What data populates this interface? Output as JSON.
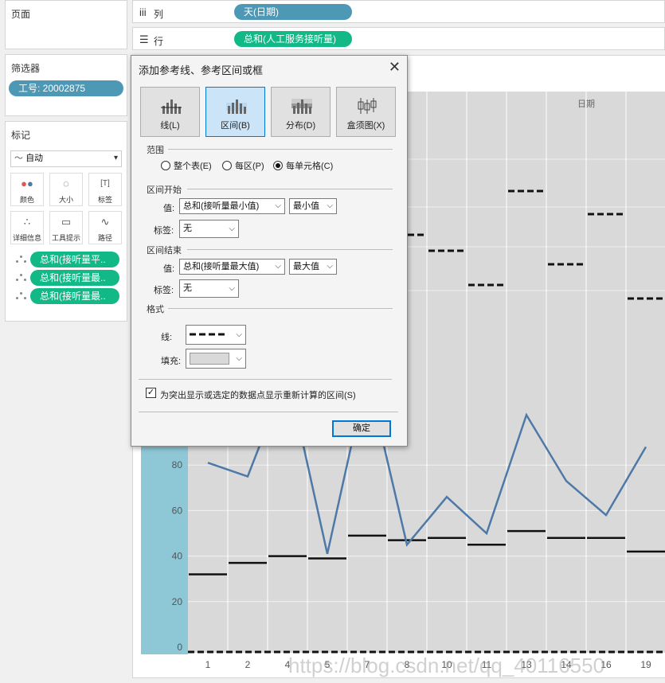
{
  "left": {
    "pages_title": "页面",
    "filters_title": "筛选器",
    "filter_pill": "工号: 20002875",
    "marks_title": "标记",
    "mark_type": "自动",
    "mark_buttons": [
      {
        "label": "颜色",
        "icon": "color-dots-icon"
      },
      {
        "label": "大小",
        "icon": "size-icon"
      },
      {
        "label": "标签",
        "icon": "label-icon"
      },
      {
        "label": "详细信息",
        "icon": "detail-icon"
      },
      {
        "label": "工具提示",
        "icon": "tooltip-icon"
      },
      {
        "label": "路径",
        "icon": "path-icon"
      }
    ],
    "mark_fields": [
      "总和(接听量平..",
      "总和(接听量最..",
      "总和(接听量最.."
    ]
  },
  "shelves": {
    "columns_label": "列",
    "columns_pill": "天(日期)",
    "rows_label": "行",
    "rows_pill": "总和(人工服务接听量)"
  },
  "chart_header": "日期",
  "dialog": {
    "title": "添加参考线、参考区间或框",
    "types": [
      {
        "label": "线(L)",
        "active": false
      },
      {
        "label": "区间(B)",
        "active": true
      },
      {
        "label": "分布(D)",
        "active": false
      },
      {
        "label": "盒须图(X)",
        "active": false
      }
    ],
    "scope_title": "范围",
    "scope_options": [
      {
        "label": "整个表(E)",
        "selected": false
      },
      {
        "label": "每区(P)",
        "selected": false
      },
      {
        "label": "每单元格(C)",
        "selected": true
      }
    ],
    "start_title": "区间开始",
    "value_label": "值:",
    "label_label": "标签:",
    "start_value": "总和(接听量最小值)",
    "start_agg": "最小值",
    "start_tag": "无",
    "end_title": "区间结束",
    "end_value": "总和(接听量最大值)",
    "end_agg": "最大值",
    "end_tag": "无",
    "format_title": "格式",
    "line_label": "线:",
    "fill_label": "填充:",
    "recalc_label": "为突出显示或选定的数据点显示重新计算的区间(S)",
    "recalc_checked": true,
    "ok_label": "确定"
  },
  "chart_data": {
    "type": "line",
    "x_tick_labels": [
      "1",
      "2",
      "4",
      "5",
      "7",
      "8",
      "10",
      "11",
      "13",
      "14",
      "16",
      "19"
    ],
    "y_tick_labels": [
      "0",
      "20",
      "40",
      "60",
      "80"
    ],
    "ylim": [
      0,
      100
    ],
    "series": [
      {
        "name": "总和(人工服务接听量)",
        "color": "#4e79a7",
        "values": [
          81,
          75,
          120,
          41,
          120,
          45,
          66,
          50,
          102,
          73,
          58,
          88
        ]
      }
    ],
    "band_bottom_values": [
      32,
      37,
      40,
      39,
      49,
      47,
      48,
      45,
      51,
      48,
      48,
      42
    ],
    "band_top_values": [
      null,
      null,
      null,
      null,
      null,
      183,
      177,
      162,
      199,
      169,
      189,
      156
    ],
    "band_fill": "#d9d9d9",
    "highlight_color": "#8ec7d6",
    "watermark": "https://blog.csdn.net/qq_40116550"
  }
}
